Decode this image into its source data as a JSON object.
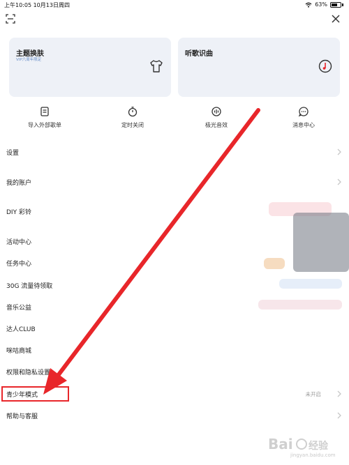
{
  "status_bar": {
    "time_date": "上午10:05   10月13日周四",
    "battery_percent": "63%"
  },
  "cards": {
    "theme": {
      "title": "主题换肤",
      "subtitle": "VIP六周年限定"
    },
    "song_recognition": {
      "title": "听歌识曲"
    }
  },
  "quick_actions": [
    {
      "label": "导入外部歌单",
      "icon": "import-playlist-icon"
    },
    {
      "label": "定时关闭",
      "icon": "timer-icon"
    },
    {
      "label": "极光音效",
      "icon": "sound-effect-icon"
    },
    {
      "label": "消息中心",
      "icon": "message-icon"
    }
  ],
  "menu": [
    {
      "label": "设置"
    },
    {
      "label": "我的账户"
    },
    {
      "label": "DIY 彩铃"
    },
    {
      "label": "活动中心"
    },
    {
      "label": "任务中心"
    },
    {
      "label": "30G 流量待领取"
    },
    {
      "label": "音乐公益"
    },
    {
      "label": "达人CLUB"
    },
    {
      "label": "咪咕商城"
    },
    {
      "label": "权限和隐私设置"
    },
    {
      "label": "青少年模式",
      "status": "未开启"
    },
    {
      "label": "帮助与客服"
    }
  ],
  "watermark": {
    "text": "jingyan.baidu.com"
  },
  "colors": {
    "annotation_red": "#e8262a",
    "card_bg": "#eef1f7"
  }
}
